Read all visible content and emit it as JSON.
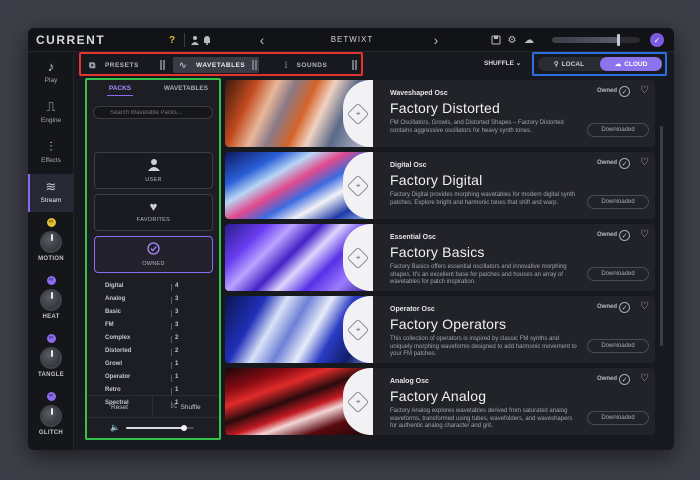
{
  "app": {
    "logo": "CURRENT",
    "preset_name": "BETWIXT",
    "avatar_icon": "✓"
  },
  "topbar": {
    "help": "?",
    "meter_level": 0.75
  },
  "sidebar": {
    "nav": [
      {
        "label": "Play",
        "icon": "♪"
      },
      {
        "label": "Engine",
        "icon": "⎍"
      },
      {
        "label": "Effects",
        "icon": "⫶"
      },
      {
        "label": "Stream",
        "icon": "≋"
      }
    ],
    "macros": [
      {
        "label": "MOTION",
        "led_color": "#e2c12e",
        "led_glyph": "∞"
      },
      {
        "label": "HEAT",
        "led_color": "#8b6cf0",
        "led_glyph": "∞"
      },
      {
        "label": "TANGLE",
        "led_color": "#8b6cf0",
        "led_glyph": "∞"
      },
      {
        "label": "GLITCH",
        "led_color": "#8b6cf0",
        "led_glyph": "∞"
      }
    ]
  },
  "tabs": {
    "presets": "PRESETS",
    "wavetables": "WAVETABLES",
    "sounds": "SOUNDS"
  },
  "shuffle_top": "SHUFFLE ⌄",
  "location": {
    "local": "LOCAL",
    "cloud": "CLOUD",
    "selected": "CLOUD"
  },
  "browser": {
    "subtabs": {
      "packs": "PACKS",
      "wavetables": "WAVETABLES"
    },
    "search_placeholder": "Search Wavetable Packs...",
    "filters": {
      "user": "USER",
      "favorites": "FAVORITES",
      "owned": "OWNED"
    },
    "categories": [
      {
        "name": "Digital",
        "count": "4"
      },
      {
        "name": "Analog",
        "count": "3"
      },
      {
        "name": "Basic",
        "count": "3"
      },
      {
        "name": "FM",
        "count": "3"
      },
      {
        "name": "Complex",
        "count": "2"
      },
      {
        "name": "Distorted",
        "count": "2"
      },
      {
        "name": "Growl",
        "count": "1"
      },
      {
        "name": "Operator",
        "count": "1"
      },
      {
        "name": "Retro",
        "count": "1"
      },
      {
        "name": "Spectral",
        "count": "1"
      }
    ],
    "reset": "Reset",
    "shuffle": "Shuffle",
    "volume": 0.85
  },
  "packs": [
    {
      "subtitle": "Waveshaped Osc",
      "title": "Factory Distorted",
      "description": "FM Oscillators, Growls, and Distorted Shapes – Factory Distorted contains aggressive oscillators for heavy synth tones.",
      "owned": "Owned",
      "button": "Downloaded",
      "art": "linear-gradient(115deg,#3a1a10 0%,#c24a1e 18%,#e8b79a 30%,#8a7a86 40%,#d4642a 52%,#f0d2c2 62%,#5a6a8a 75%,#c8c8d6 100%)"
    },
    {
      "subtitle": "Digital Osc",
      "title": "Factory Digital",
      "description": "Factory Digital provides morphing wavetables for modern digital synth patches. Explore bright and harmonic tones that shift and warp.",
      "owned": "Owned",
      "button": "Downloaded",
      "art": "linear-gradient(150deg,#0c1a5e 0%,#2a5fd8 22%,#b8d6f4 34%,#e04a8c 46%,#3b6be0 58%,#f2f2f6 70%,#1e3aa8 85%,#9fc2f0 100%)"
    },
    {
      "subtitle": "Essential Osc",
      "title": "Factory Basics",
      "description": "Factory Basics offers essential oscillators and innovative morphing shapes. It's an excellent base for patches and houses an array of wavetables for patch inspiration.",
      "owned": "Owned",
      "button": "Downloaded",
      "art": "linear-gradient(135deg,#2a1c8e 0%,#6a3df0 20%,#b9a4ff 32%,#4422c8 45%,#e0d6ff 55%,#5630e6 68%,#9d7cff 82%,#2c1a88 100%)"
    },
    {
      "subtitle": "Operator Osc",
      "title": "Factory Operators",
      "description": "This collection of operators is inspired by classic FM synths and uniquely morphing waveforms designed to add harmonic movement to your FM patches.",
      "owned": "Owned",
      "button": "Downloaded",
      "art": "linear-gradient(120deg,#0a1450 0%,#2030b8 22%,#d8e2f6 34%,#6e80d6 46%,#e6ecfa 58%,#2a3cc4 70%,#101c6a 85%,#8090e0 100%)"
    },
    {
      "subtitle": "Analog Osc",
      "title": "Factory Analog",
      "description": "Factory Analog explores wavetables derived from saturated analog waveforms, transformed using tubes, wavefolders, and waveshapers for authentic analog character and grit.",
      "owned": "Owned",
      "button": "Downloaded",
      "art": "linear-gradient(160deg,#1a0608 0%,#8a0c14 20%,#e02a2a 32%,#2a0a0c 46%,#c41a22 58%,#f4d6d6 66%,#5a0a10 80%,#1a0608 100%)"
    }
  ]
}
